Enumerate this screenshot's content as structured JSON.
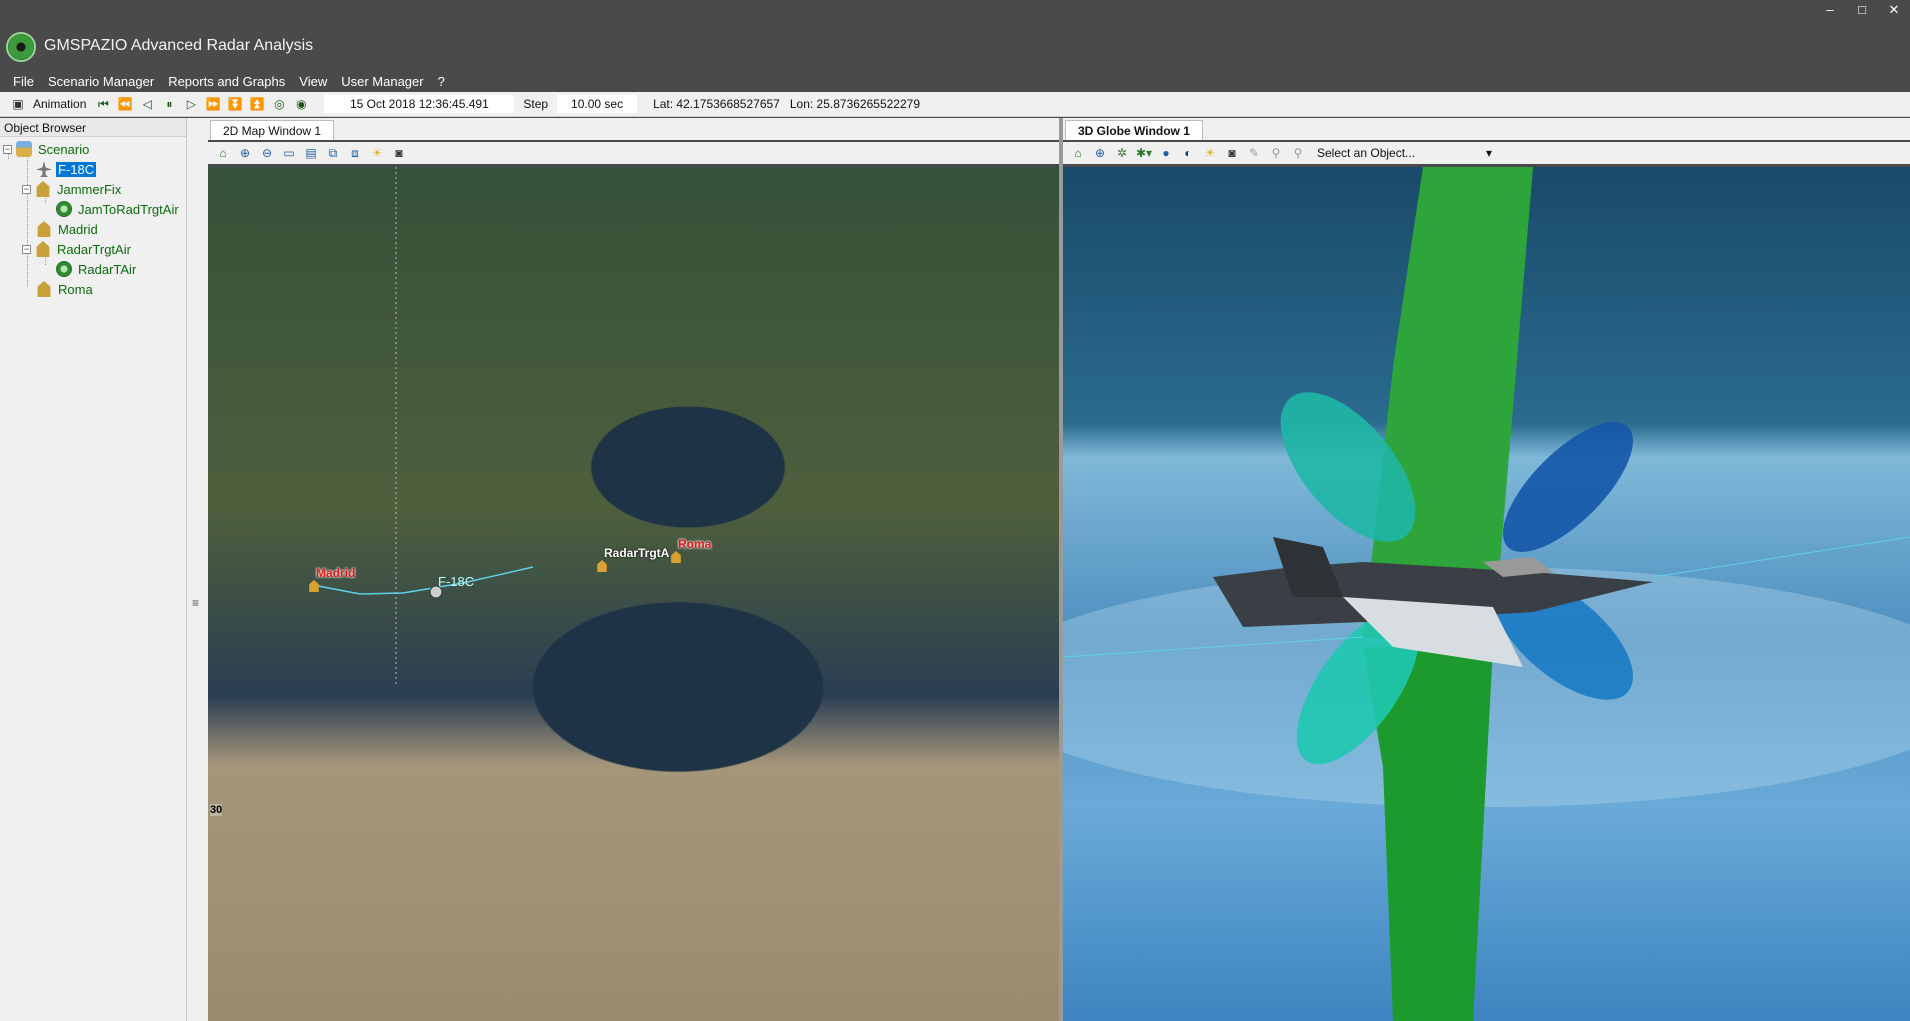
{
  "window": {
    "title": "GMSPAZIO Advanced Radar Analysis",
    "controls": [
      "–",
      "□",
      "✕"
    ]
  },
  "menu": [
    "File",
    "Scenario Manager",
    "Reports and Graphs",
    "View",
    "User Manager",
    "?"
  ],
  "toolbar": {
    "animation_label": "Animation",
    "datetime": "15 Oct 2018 12:36:45.491",
    "step_label": "Step",
    "step_value": "10.00 sec",
    "lat": "Lat: 42.1753668527657",
    "lon": "Lon: 25.8736265522279"
  },
  "object_browser": {
    "title": "Object Browser",
    "nodes": [
      {
        "label": "Scenario",
        "icon": "scenario-icon"
      },
      {
        "label": "F-18C",
        "icon": "aircraft-icon",
        "selected": true
      },
      {
        "label": "JammerFix",
        "icon": "facility-icon"
      },
      {
        "label": "JamToRadTrgtAir",
        "icon": "radar-icon"
      },
      {
        "label": "Madrid",
        "icon": "facility-icon"
      },
      {
        "label": "RadarTrgtAir",
        "icon": "facility-icon"
      },
      {
        "label": "RadarTAir",
        "icon": "radar-icon"
      },
      {
        "label": "Roma",
        "icon": "facility-icon"
      }
    ]
  },
  "map_window": {
    "tab": "2D Map Window 1",
    "labels": {
      "madrid": "Madrid",
      "f18c": "F-18C",
      "radar": "RadarTrgtA",
      "roma": "Roma"
    },
    "grid_label": "30"
  },
  "globe_window": {
    "tab": "3D Globe Window 1",
    "select_placeholder": "Select an Object..."
  },
  "colors": {
    "title_bg": "#4a4a4a",
    "selection": "#0078d7",
    "tree_text": "#0d6b0d",
    "red_label": "#e01818",
    "track_cyan": "#5fd0e8"
  }
}
